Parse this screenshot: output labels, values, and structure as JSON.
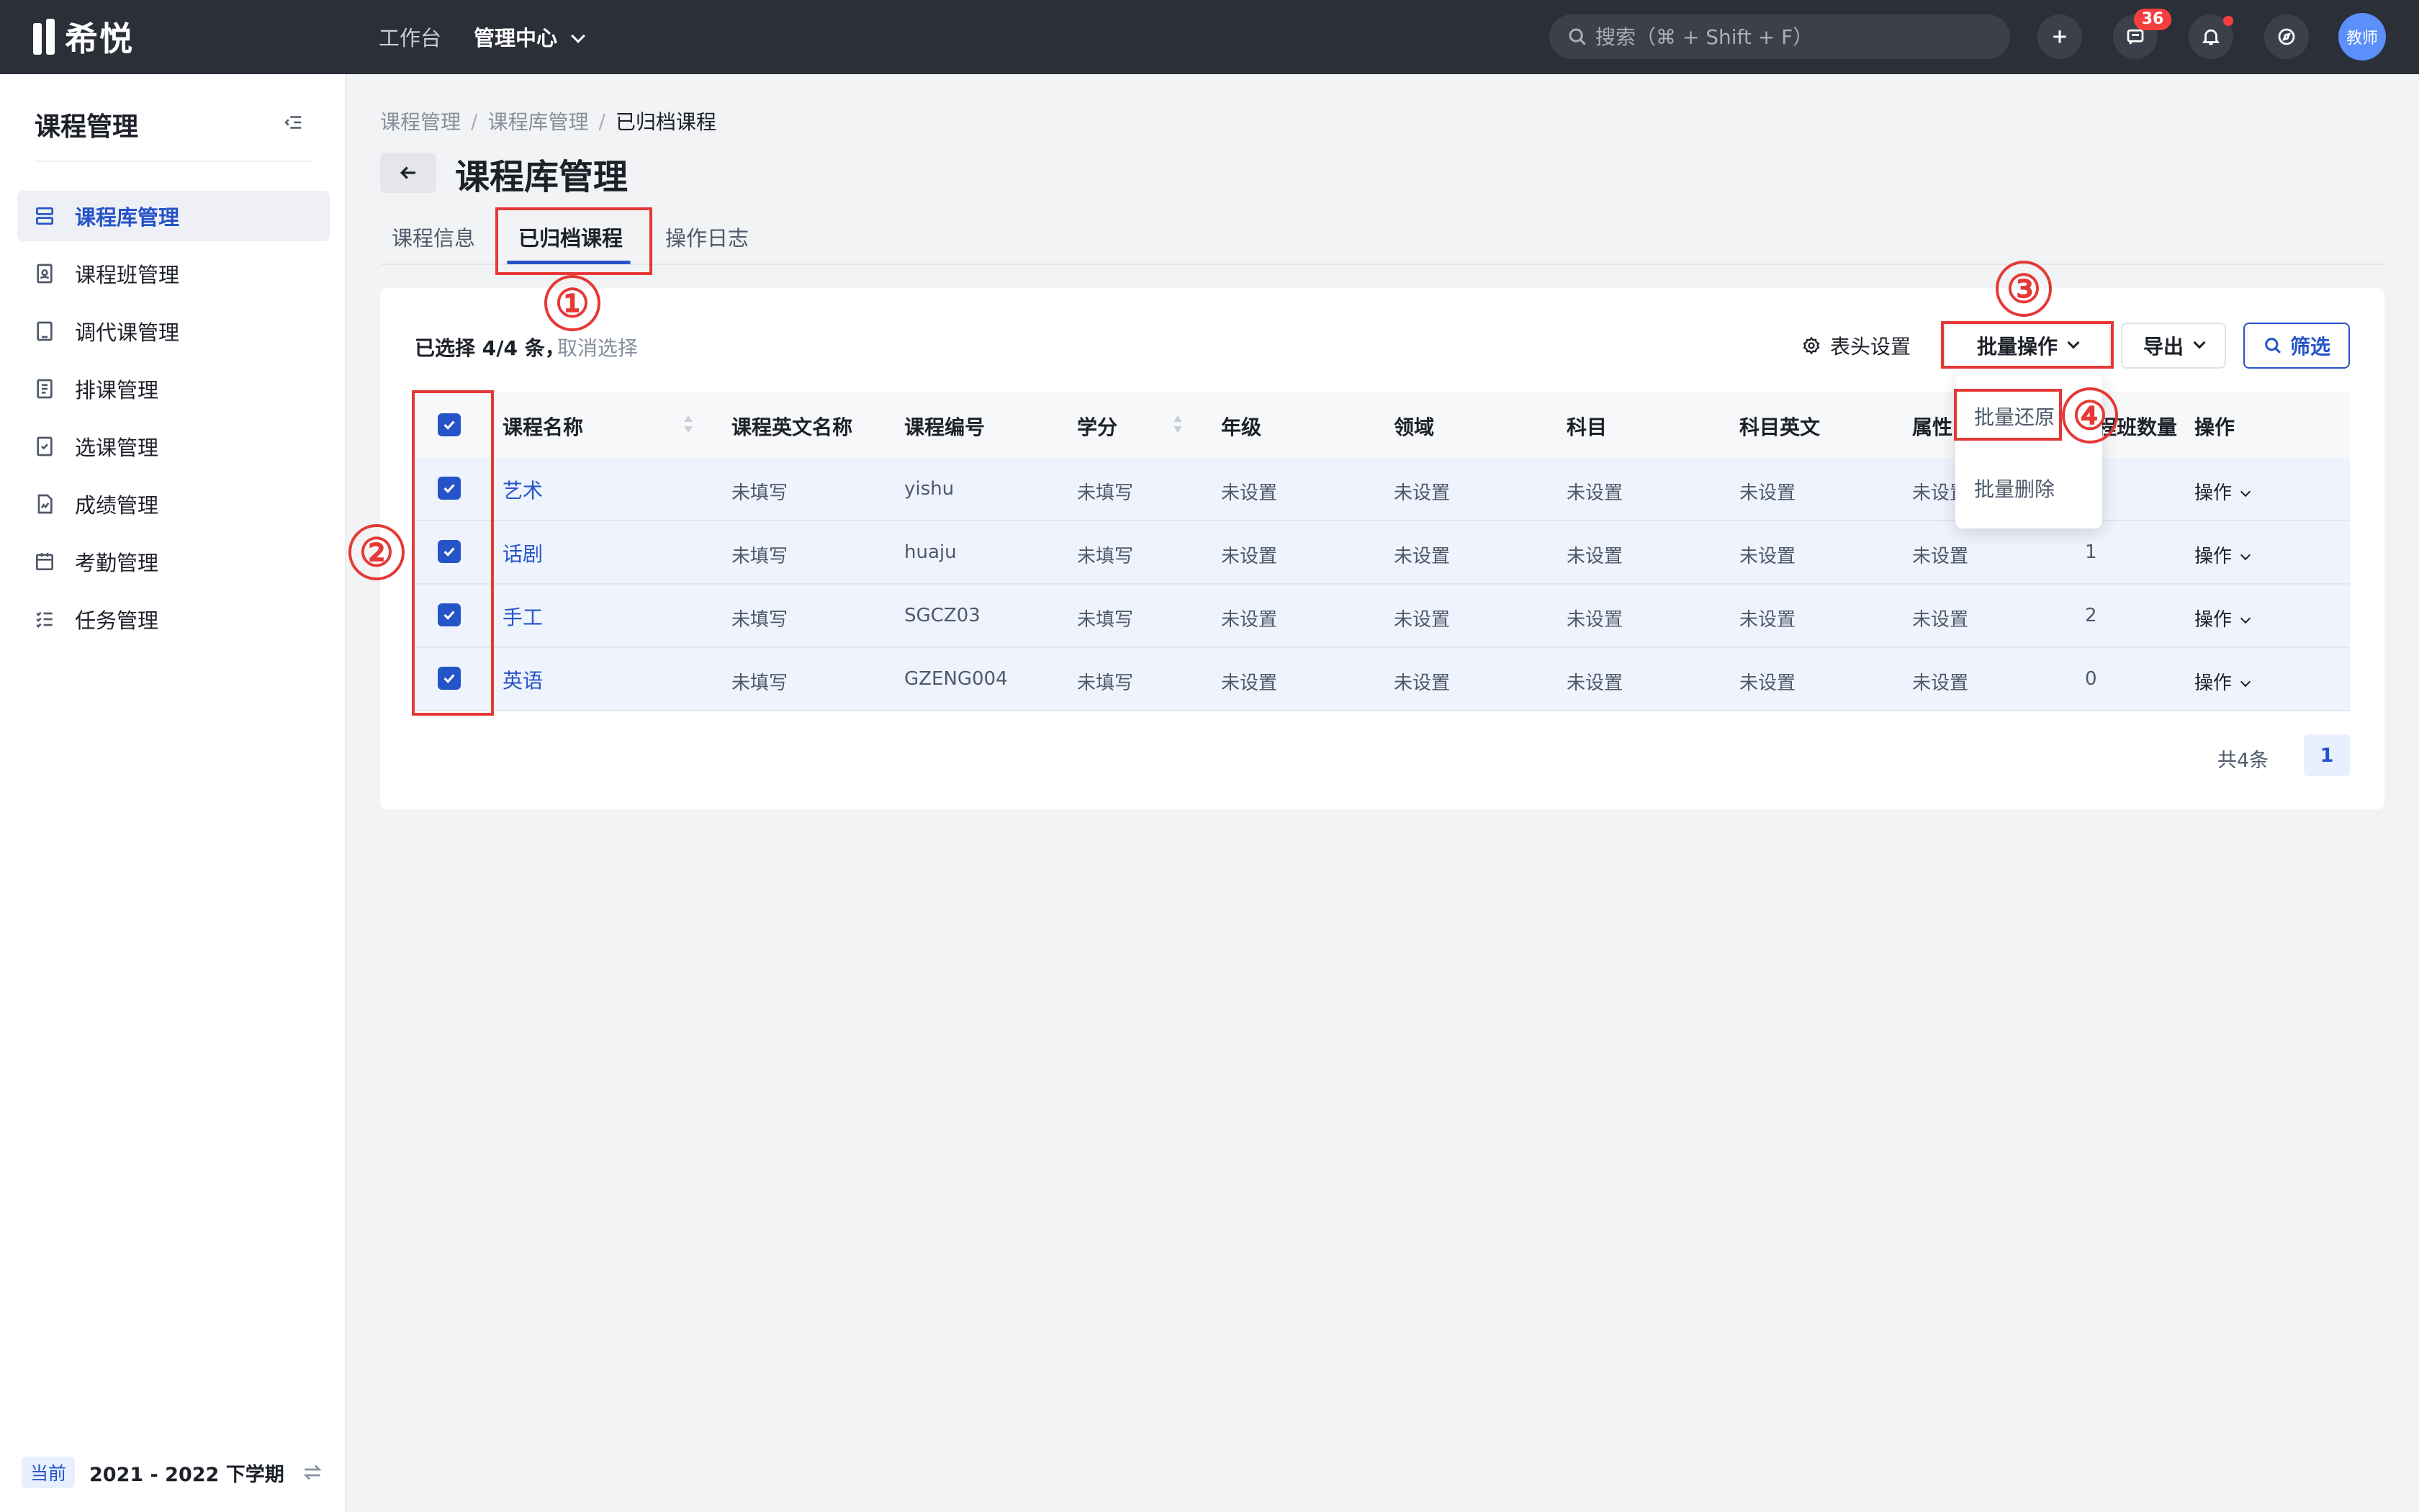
{
  "topbar": {
    "logo_text": "希悦",
    "nav": [
      {
        "label": "工作台"
      },
      {
        "label": "管理中心"
      }
    ],
    "search_placeholder": "搜索（⌘ + Shift + F）",
    "message_badge": "36",
    "avatar_text": "教师"
  },
  "sidebar": {
    "title": "课程管理",
    "items": [
      {
        "label": "课程库管理",
        "icon": "database-icon"
      },
      {
        "label": "课程班管理",
        "icon": "class-icon"
      },
      {
        "label": "调代课管理",
        "icon": "substitute-icon"
      },
      {
        "label": "排课管理",
        "icon": "schedule-icon"
      },
      {
        "label": "选课管理",
        "icon": "checklist-icon"
      },
      {
        "label": "成绩管理",
        "icon": "score-icon"
      },
      {
        "label": "考勤管理",
        "icon": "calendar-icon"
      },
      {
        "label": "任务管理",
        "icon": "task-list-icon"
      }
    ],
    "footer": {
      "current_tag": "当前",
      "term": "2021 - 2022 下学期"
    }
  },
  "breadcrumb": [
    "课程管理",
    "课程库管理",
    "已归档课程"
  ],
  "page_title": "课程库管理",
  "tabs": [
    {
      "label": "课程信息"
    },
    {
      "label": "已归档课程"
    },
    {
      "label": "操作日志"
    }
  ],
  "toolbar": {
    "selection_text": "已选择 4/4 条，",
    "cancel_selection": "取消选择",
    "header_settings": "表头设置",
    "batch_ops": "批量操作",
    "export": "导出",
    "filter": "筛选"
  },
  "dropdown": {
    "items": [
      "批量还原",
      "批量删除"
    ]
  },
  "table": {
    "columns": [
      "课程名称",
      "课程英文名称",
      "课程编号",
      "学分",
      "年级",
      "领域",
      "科目",
      "科目英文",
      "属性",
      "课程班数量",
      "操作"
    ],
    "rows": [
      {
        "name": "艺术",
        "en_name": "未填写",
        "code": "yishu",
        "credit": "未填写",
        "grade": "未设置",
        "field": "未设置",
        "subject": "未设置",
        "subject_en": "未设置",
        "attr": "未设置",
        "class_count": "",
        "op": "操作"
      },
      {
        "name": "话剧",
        "en_name": "未填写",
        "code": "huaju",
        "credit": "未填写",
        "grade": "未设置",
        "field": "未设置",
        "subject": "未设置",
        "subject_en": "未设置",
        "attr": "未设置",
        "class_count": "1",
        "op": "操作"
      },
      {
        "name": "手工",
        "en_name": "未填写",
        "code": "SGCZ03",
        "credit": "未填写",
        "grade": "未设置",
        "field": "未设置",
        "subject": "未设置",
        "subject_en": "未设置",
        "attr": "未设置",
        "class_count": "2",
        "op": "操作"
      },
      {
        "name": "英语",
        "en_name": "未填写",
        "code": "GZENG004",
        "credit": "未填写",
        "grade": "未设置",
        "field": "未设置",
        "subject": "未设置",
        "subject_en": "未设置",
        "attr": "未设置",
        "class_count": "0",
        "op": "操作"
      }
    ]
  },
  "pagination": {
    "total": "共4条",
    "current": "1"
  },
  "annotations": [
    "①",
    "②",
    "③",
    "④"
  ],
  "colors": {
    "accent": "#2553c8",
    "annotation": "#e53935",
    "topbar": "#2b2f38",
    "row_selected": "#eef3fd"
  }
}
